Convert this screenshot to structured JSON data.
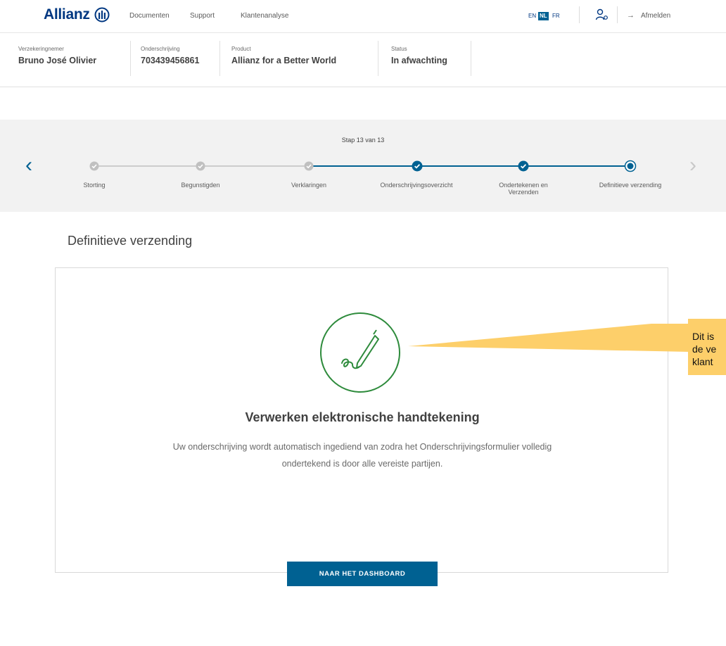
{
  "header": {
    "logo_text": "Allianz",
    "nav": [
      "Documenten",
      "Support",
      "Klantenanalyse"
    ],
    "languages": [
      {
        "code": "EN",
        "active": false
      },
      {
        "code": "NL",
        "active": true
      },
      {
        "code": "FR",
        "active": false
      }
    ],
    "logout_label": "Afmelden"
  },
  "info": [
    {
      "label": "Verzekeringnemer",
      "value": "Bruno José Olivier"
    },
    {
      "label": "Onderschrijving",
      "value": "703439456861"
    },
    {
      "label": "Product",
      "value": "Allianz for a Better World"
    },
    {
      "label": "Status",
      "value": "In afwachting"
    }
  ],
  "stepper": {
    "step_text": "Stap 13 van 13",
    "steps": [
      {
        "label": "Storting",
        "state": "done-grey"
      },
      {
        "label": "Begunstigden",
        "state": "done-grey"
      },
      {
        "label": "Verklaringen",
        "state": "done-grey"
      },
      {
        "label": "Onderschrijvingsoverzicht",
        "state": "done"
      },
      {
        "label": "Ondertekenen en Verzenden",
        "state": "done"
      },
      {
        "label": "Definitieve verzending",
        "state": "current"
      }
    ]
  },
  "page": {
    "title": "Definitieve verzending",
    "heading": "Verwerken elektronische handtekening",
    "body": "Uw onderschrijving wordt automatisch ingediend van zodra het Onderschrijvingsformulier volledig ondertekend is door alle vereiste partijen.",
    "button_label": "NAAR HET DASHBOARD"
  },
  "tooltip": {
    "text": "Dit is\nde ve\nklant"
  },
  "colors": {
    "brand": "#003781",
    "primary": "#006192",
    "success": "#2e8b3c",
    "tooltip": "#fdcf6a"
  }
}
